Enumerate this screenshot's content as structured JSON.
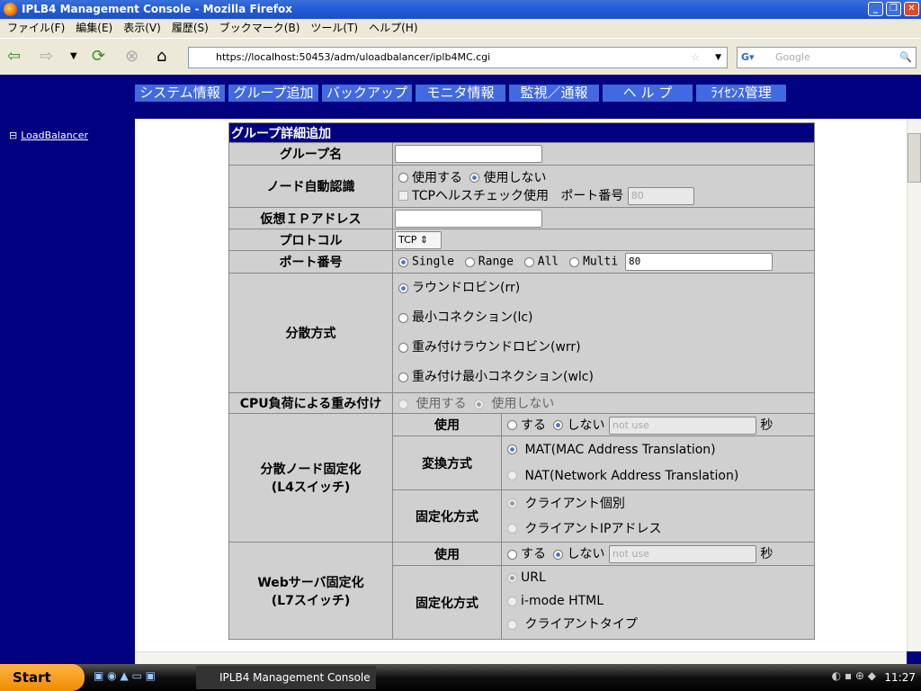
{
  "window": {
    "title": "IPLB4 Management Console - Mozilla Firefox"
  },
  "menu": [
    "ファイル(F)",
    "編集(E)",
    "表示(V)",
    "履歴(S)",
    "ブックマーク(B)",
    "ツール(T)",
    "ヘルプ(H)"
  ],
  "nav": {
    "url": "https://localhost:50453/adm/uloadbalancer/iplb4MC.cgi",
    "search_placeholder": "Google"
  },
  "topnav": [
    "システム情報",
    "グループ追加",
    "バックアップ",
    "モニタ情報",
    "監視／通報",
    "ヘ ル プ",
    "ﾗｲｾﾝｽ管理"
  ],
  "tree": {
    "toggle": "⊟",
    "item": "LoadBalancer"
  },
  "form": {
    "title": "グループ詳細追加",
    "group_name": {
      "label": "グループ名",
      "value": ""
    },
    "node_auto": {
      "label": "ノード自動認識",
      "opt_use": "使用する",
      "opt_nouse": "使用しない",
      "tcp_check": "TCPヘルスチェック使用",
      "port_label": "ポート番号",
      "port_value": "80"
    },
    "vip": {
      "label": "仮想ＩＰアドレス",
      "value": ""
    },
    "protocol": {
      "label": "プロトコル",
      "value": "TCP"
    },
    "port": {
      "label": "ポート番号",
      "opts": [
        "Single",
        "Range",
        "All",
        "Multi"
      ],
      "value": "80"
    },
    "dist": {
      "label": "分散方式",
      "opts": [
        "ラウンドロビン(rr)",
        "最小コネクション(lc)",
        "重み付けラウンドロビン(wrr)",
        "重み付け最小コネクション(wlc)"
      ]
    },
    "cpu": {
      "label": "CPU負荷による重み付け",
      "opt_use": "使用する",
      "opt_nouse": "使用しない"
    },
    "l4": {
      "label1": "分散ノード固定化",
      "label2": "(L4スイッチ)",
      "use_label": "使用",
      "opt_yes": "する",
      "opt_no": "しない",
      "placeholder": "not use",
      "unit": "秒",
      "conv_label": "変換方式",
      "conv_opts": [
        "MAT(MAC Address Translation)",
        "NAT(Network Address Translation)"
      ],
      "fix_label": "固定化方式",
      "fix_opts": [
        "クライアント個別",
        "クライアントIPアドレス"
      ]
    },
    "l7": {
      "label1": "Webサーバ固定化",
      "label2": "(L7スイッチ)",
      "use_label": "使用",
      "opt_yes": "する",
      "opt_no": "しない",
      "placeholder": "not use",
      "unit": "秒",
      "fix_label": "固定化方式",
      "fix_opts": [
        "URL",
        "i-mode HTML",
        "クライアントタイプ"
      ]
    }
  },
  "taskbar": {
    "start": "Start",
    "task": "IPLB4 Management Console",
    "clock": "11:27"
  }
}
